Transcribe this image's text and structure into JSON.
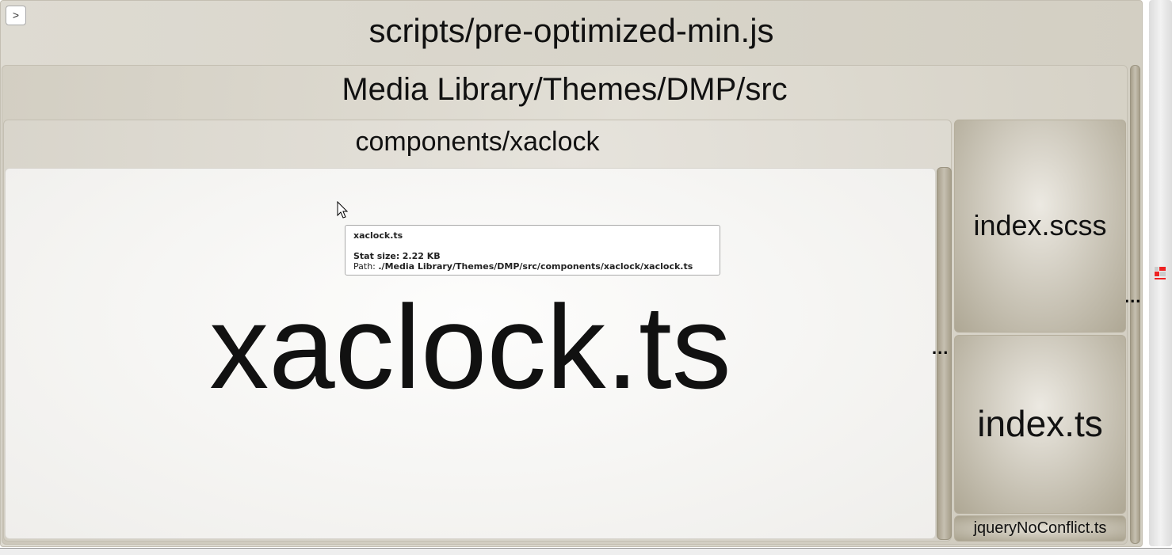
{
  "toggle_button": ">",
  "nodes": {
    "root": "scripts/pre-optimized-min.js",
    "src": "Media Library/Themes/DMP/src",
    "components": "components/xaclock",
    "xaclock": "xaclock.ts",
    "scss": "index.scss",
    "index_ts": "index.ts",
    "jquery": "jqueryNoConflict.ts",
    "ellipsis": "..."
  },
  "tooltip": {
    "name": "xaclock.ts",
    "stat_label": "Stat size:",
    "stat_value": "2.22 KB",
    "path_label": "Path:",
    "path_value": "./Media Library/Themes/DMP/src/components/xaclock/xaclock.ts"
  }
}
